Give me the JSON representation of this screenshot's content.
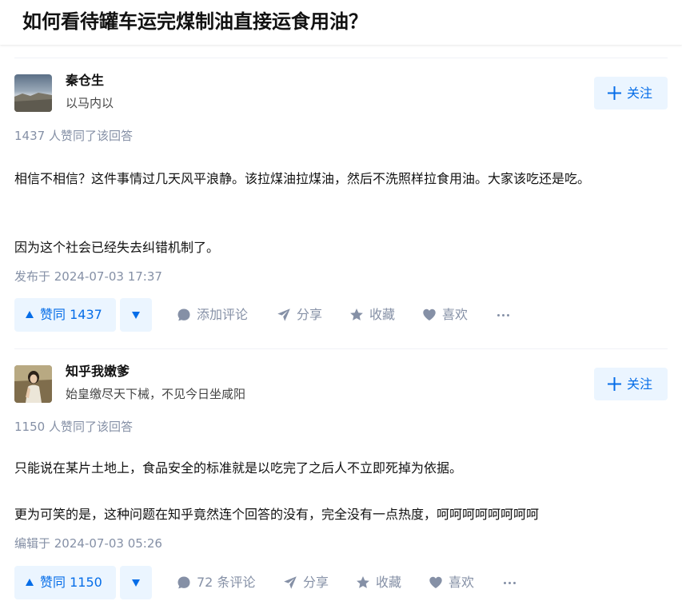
{
  "question": {
    "title": "如何看待罐车运完煤制油直接运食用油？"
  },
  "answers": [
    {
      "author_name": "秦仓生",
      "author_bio": "以马内以",
      "follow_label": "关注",
      "vote_summary": "1437 人赞同了该回答",
      "paragraphs": [
        "相信不相信？这件事情过几天风平浪静。该拉煤油拉煤油，然后不洗照样拉食用油。大家该吃还是吃。",
        "因为这个社会已经失去纠错机制了。"
      ],
      "timestamp": "发布于 2024-07-03 17:37",
      "vote_label": "赞同 1437",
      "comment_label": "添加评论",
      "share_label": "分享",
      "collect_label": "收藏",
      "like_label": "喜欢"
    },
    {
      "author_name": "知乎我嫩爹",
      "author_bio": "始皇缴尽天下械，不见今日坐咸阳",
      "follow_label": "关注",
      "vote_summary": "1150 人赞同了该回答",
      "paragraphs": [
        "只能说在某片土地上，食品安全的标准就是以吃完了之后人不立即死掉为依据。",
        "更为可笑的是，这种问题在知乎竟然连个回答的没有，完全没有一点热度，呵呵呵呵呵呵呵呵"
      ],
      "timestamp": "编辑于 2024-07-03 05:26",
      "vote_label": "赞同 1150",
      "comment_label": "72 条评论",
      "share_label": "分享",
      "collect_label": "收藏",
      "like_label": "喜欢"
    }
  ],
  "colors": {
    "accent": "#056de8",
    "accent_bg": "#ebf5ff",
    "muted": "#8590a6",
    "text": "#121212"
  },
  "icons": {
    "follow": "plus-icon",
    "vote_up": "triangle-up-icon",
    "vote_down": "triangle-down-icon",
    "comment": "comment-bubble-icon",
    "share": "paper-plane-icon",
    "collect": "star-icon",
    "like": "heart-icon",
    "more": "more-dots-icon"
  }
}
